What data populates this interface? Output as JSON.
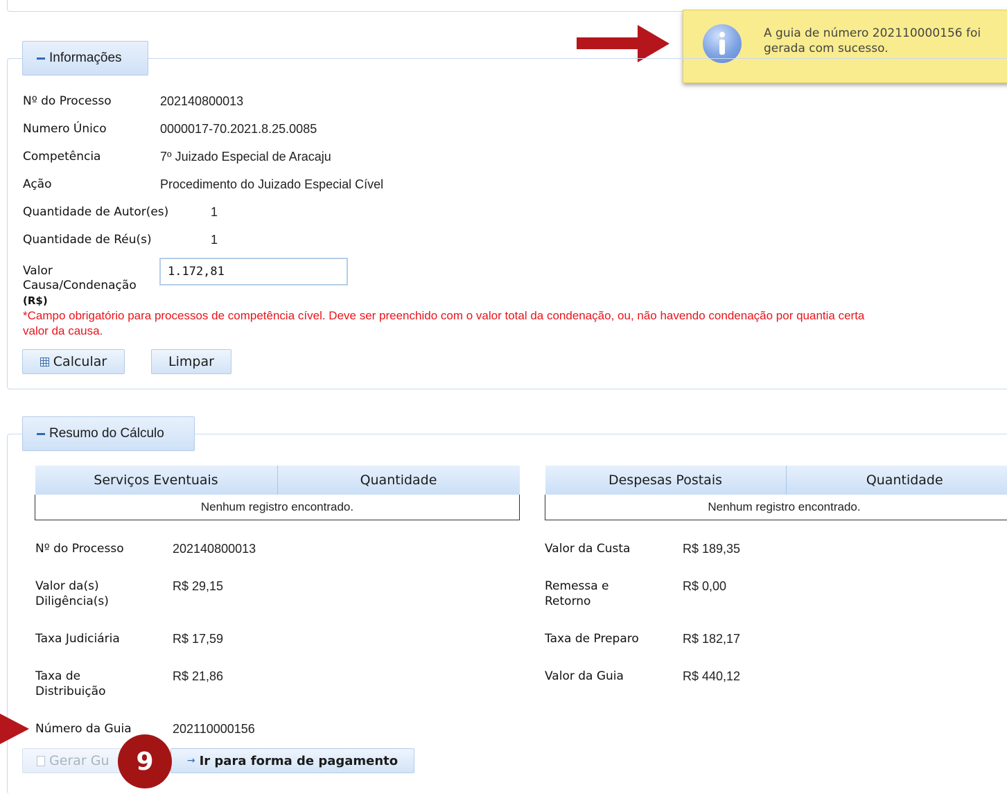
{
  "toast": {
    "message": "A guia de número 202110000156 foi gerada com sucesso.",
    "icon": "info-icon",
    "background": "#f9ec8e"
  },
  "info": {
    "legend": "Informações",
    "fields": [
      {
        "label": "Nº do Processo",
        "value": "202140800013"
      },
      {
        "label": "Numero Único",
        "value": "0000017-70.2021.8.25.0085"
      },
      {
        "label": "Competência",
        "value": "7º Juizado Especial de Aracaju"
      },
      {
        "label": "Ação",
        "value": "Procedimento do Juizado Especial Cível"
      },
      {
        "label": "Quantidade de Autor(es)",
        "value": "1"
      },
      {
        "label": "Quantidade de Réu(s)",
        "value": "1"
      }
    ],
    "valor_label_1": "Valor",
    "valor_label_2": "Causa/Condenação",
    "valor_label_3": "(R$)",
    "valor_value": "1.172,81",
    "note_line1": "*Campo obrigatório para processos de competência cível. Deve ser preenchido com o valor total da condenação, ou, não havendo condenação por quantia certa",
    "note_line2": "valor da causa.",
    "calcular_label": "Calcular",
    "limpar_label": "Limpar"
  },
  "resumo": {
    "legend": "Resumo do Cálculo",
    "table_left": {
      "headers": [
        "Serviços Eventuais",
        "Quantidade"
      ],
      "empty": "Nenhum registro encontrado."
    },
    "table_right": {
      "headers": [
        "Despesas Postais",
        "Quantidade"
      ],
      "empty": "Nenhum registro encontrado."
    },
    "left": {
      "processo_label": "Nº do Processo",
      "processo_value": "202140800013",
      "diligencia_label_1": "Valor da(s)",
      "diligencia_label_2": "Diligência(s)",
      "diligencia_value": "R$ 29,15",
      "taxa_judiciaria_label": "Taxa Judiciária",
      "taxa_judiciaria_value": "R$ 17,59",
      "taxa_distribuicao_label_1": "Taxa de",
      "taxa_distribuicao_label_2": "Distribuição",
      "taxa_distribuicao_value": "R$ 21,86",
      "numero_guia_label": "Número da Guia",
      "numero_guia_value": "202110000156"
    },
    "right": {
      "custa_label": "Valor da Custa",
      "custa_value": "R$ 189,35",
      "remessa_label_1": "Remessa e",
      "remessa_label_2": "Retorno",
      "remessa_value": "R$ 0,00",
      "preparo_label": "Taxa de Preparo",
      "preparo_value": "R$ 182,17",
      "guia_label": "Valor da Guia",
      "guia_value": "R$ 440,12"
    },
    "gerar_label": "Gerar Gu",
    "ir_label": "Ir para forma de pagamento"
  },
  "badge": "9",
  "colors": {
    "accent": "#2e6bb4",
    "arrow": "#b5161b",
    "error": "#e8141b"
  }
}
